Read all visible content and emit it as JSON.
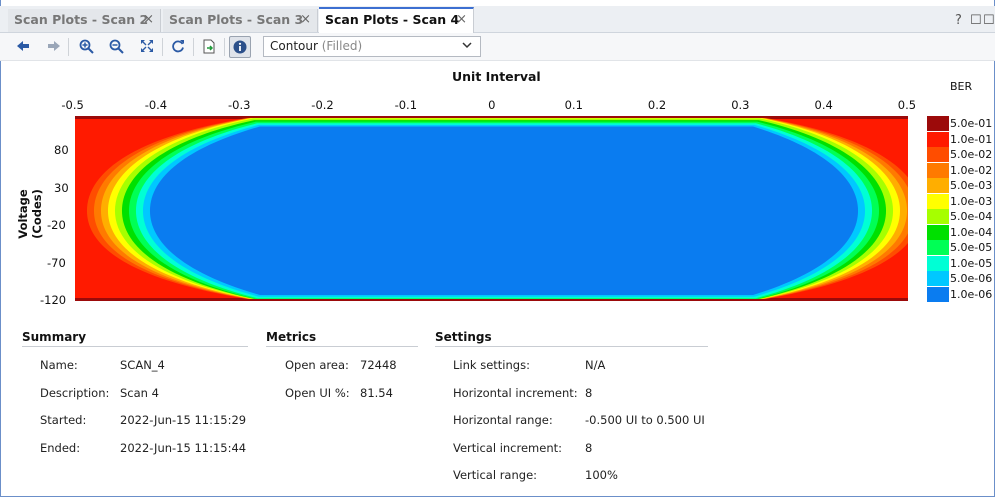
{
  "tabs": [
    {
      "label": "Scan Plots - Scan 2"
    },
    {
      "label": "Scan Plots - Scan 3"
    },
    {
      "label": "Scan Plots - Scan 4"
    }
  ],
  "window_controls": {
    "help": "?",
    "restore": "☐",
    "maximize": "☐"
  },
  "toolbar": {
    "icons": [
      "back-icon",
      "forward-icon",
      "zoom-in-icon",
      "zoom-out-icon",
      "fit-icon",
      "refresh-icon",
      "export-icon",
      "info-icon"
    ],
    "plot_type": {
      "value": "Contour",
      "qualifier": "(Filled)"
    }
  },
  "chart_data": {
    "type": "heatmap",
    "xlabel": "Unit Interval",
    "ylabel": "Voltage (Codes)",
    "x_ticks": [
      "-0.5",
      "-0.4",
      "-0.3",
      "-0.2",
      "-0.1",
      "0",
      "0.1",
      "0.2",
      "0.3",
      "0.4",
      "0.5"
    ],
    "y_ticks": [
      "80",
      "30",
      "-20",
      "-70",
      "-120"
    ],
    "xlim": [
      -0.5,
      0.5
    ],
    "ylim": [
      -120,
      127
    ],
    "legend_title": "BER",
    "legend_position": "right",
    "legend": [
      {
        "label": "5.0e-01",
        "color": "#9c0a0a"
      },
      {
        "label": "1.0e-01",
        "color": "#ff1a00"
      },
      {
        "label": "5.0e-02",
        "color": "#ff4d00"
      },
      {
        "label": "1.0e-02",
        "color": "#ff7a00"
      },
      {
        "label": "5.0e-03",
        "color": "#ffae00"
      },
      {
        "label": "1.0e-03",
        "color": "#ffff00"
      },
      {
        "label": "5.0e-04",
        "color": "#a6ff00"
      },
      {
        "label": "1.0e-04",
        "color": "#00e000"
      },
      {
        "label": "5.0e-05",
        "color": "#00ff55"
      },
      {
        "label": "1.0e-05",
        "color": "#00ffd5"
      },
      {
        "label": "5.0e-06",
        "color": "#00c8ff"
      },
      {
        "label": "1.0e-06",
        "color": "#0a7cf0"
      }
    ],
    "open_eye": {
      "x_range": [
        -0.41,
        0.44
      ],
      "y_range": [
        -112,
        113
      ]
    }
  },
  "summary": {
    "title": "Summary",
    "rows": [
      {
        "label": "Name:",
        "value": "SCAN_4"
      },
      {
        "label": "Description:",
        "value": "Scan 4"
      },
      {
        "label": "Started:",
        "value": "2022-Jun-15 11:15:29"
      },
      {
        "label": "Ended:",
        "value": "2022-Jun-15 11:15:44"
      }
    ]
  },
  "metrics": {
    "title": "Metrics",
    "rows": [
      {
        "label": "Open area:",
        "value": "72448"
      },
      {
        "label": "Open UI %:",
        "value": "81.54"
      }
    ]
  },
  "settings": {
    "title": "Settings",
    "rows": [
      {
        "label": "Link settings:",
        "value": "N/A"
      },
      {
        "label": "Horizontal increment:",
        "value": "8"
      },
      {
        "label": "Horizontal range:",
        "value": "-0.500 UI to 0.500 UI"
      },
      {
        "label": "Vertical increment:",
        "value": "8"
      },
      {
        "label": "Vertical range:",
        "value": "100%"
      }
    ]
  }
}
